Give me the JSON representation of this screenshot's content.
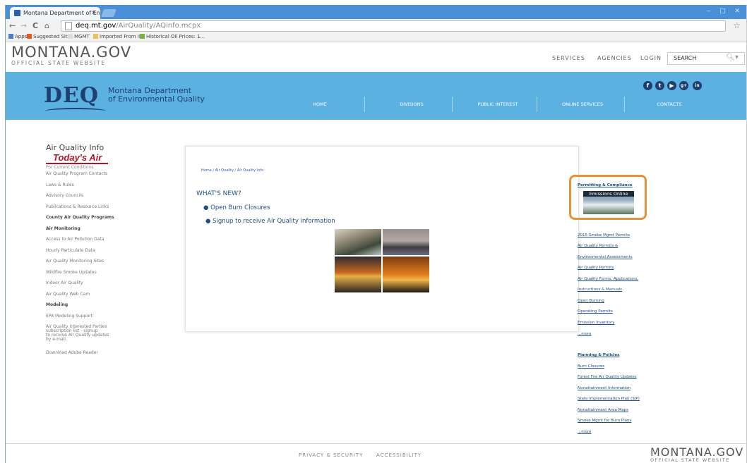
{
  "browser": {
    "tab_title": "Montana Department of En",
    "tab_close": "×",
    "window_controls": "‒ □ ✕",
    "url_domain": "deq.mt.gov",
    "url_path": "/AirQuality/AQinfo.mcpx",
    "bookmarks": [
      "Apps",
      "Suggested Sites",
      "MGMT",
      "Imported From IE",
      "Historical Oil Prices: 1..."
    ],
    "nav": {
      "back": "←",
      "forward": "→",
      "reload": "C",
      "home": "⌂"
    },
    "star": "☆"
  },
  "site": {
    "logo_big": "MONTANA.GOV",
    "logo_small": "OFFICIAL STATE WEBSITE",
    "top_nav": [
      "SERVICES",
      "AGENCIES",
      "LOGIN"
    ],
    "search_label": "SEARCH",
    "search_icon": "🔍︎▾"
  },
  "banner": {
    "deq": "DEQ",
    "dept_line1": "Montana Department",
    "dept_line2": "of Environmental Quality",
    "nav": [
      "HOME",
      "DIVISIONS",
      "PUBLIC INTEREST",
      "ONLINE SERVICES",
      "CONTACTS"
    ],
    "social": [
      "f",
      "t",
      "▶",
      "g+",
      "in"
    ],
    "social_icons": [
      "facebook-icon",
      "twitter-icon",
      "youtube-icon",
      "google-plus-icon",
      "linkedin-icon"
    ]
  },
  "leftnav": {
    "title": "Air Quality Info",
    "todays_air": "Today's Air",
    "todays_sub": "For Current Conditions",
    "items": [
      {
        "label": "Air Quality Program Contacts",
        "bold": false
      },
      {
        "label": "Laws & Rules",
        "bold": false
      },
      {
        "label": "Advisory Councils",
        "bold": false
      },
      {
        "label": "Publications & Resource Links",
        "bold": false
      },
      {
        "label": "County Air Quality Programs",
        "bold": true
      },
      {
        "label": "Air Monitoring",
        "bold": true
      },
      {
        "label": "Access to Air Pollution Data",
        "bold": false
      },
      {
        "label": "Hourly Particulate Data",
        "bold": false
      },
      {
        "label": "Air Quality Monitoring Sites",
        "bold": false
      },
      {
        "label": "Wildfire Smoke Updates",
        "bold": false
      },
      {
        "label": "Indoor Air Quality",
        "bold": false
      },
      {
        "label": "Air Quality Web Cam",
        "bold": false
      },
      {
        "label": "Modeling",
        "bold": true
      },
      {
        "label": "EPA Modeling Support",
        "bold": false
      }
    ],
    "subscribe": [
      "Air Quality Interested Parties",
      "subscription list - signup",
      "to receive Air Quality updates",
      "by e-mail."
    ],
    "download": "Download Adobe Reader"
  },
  "main": {
    "breadcrumb": "Home / Air Quality / Air Quality Info",
    "whats_new": "WHAT'S NEW?",
    "bullets": [
      "Open Burn Closures",
      "Signup to receive Air Quality information"
    ]
  },
  "rightcol": {
    "permitting_head": "Permitting & Compliance",
    "emissions_label": "Emissions Online",
    "permit_links": [
      "2015 Smoke Mgmt Permits",
      "Air Quality Permits &",
      "Environmental Assessments",
      "Air Quality Permits",
      "Air Quality Forms, Applications,",
      "Instructions & Manuals",
      "Open Burning",
      "Operating Permits",
      "Emission Inventory",
      "...more"
    ],
    "planning_head": "Planning & Policies",
    "planning_links": [
      "Burn Closures",
      "Forest Fire Air Quality Updates",
      "Nonattainment Information",
      "State Implementation Plan (SIP)",
      "Nonattainment Area Maps",
      "Smoke Mgmt for Burn Plans",
      "...more"
    ]
  },
  "footer": {
    "links": [
      "PRIVACY & SECURITY",
      "ACCESSIBILITY"
    ],
    "logo_big": "MONTANA.GOV",
    "logo_small": "OFFICIAL STATE WEBSITE"
  },
  "colors": {
    "banner": "#5bb1e0",
    "deq_navy": "#1e3f70",
    "highlight_orange": "#e6923a",
    "todays_air_red": "#b0162a"
  }
}
